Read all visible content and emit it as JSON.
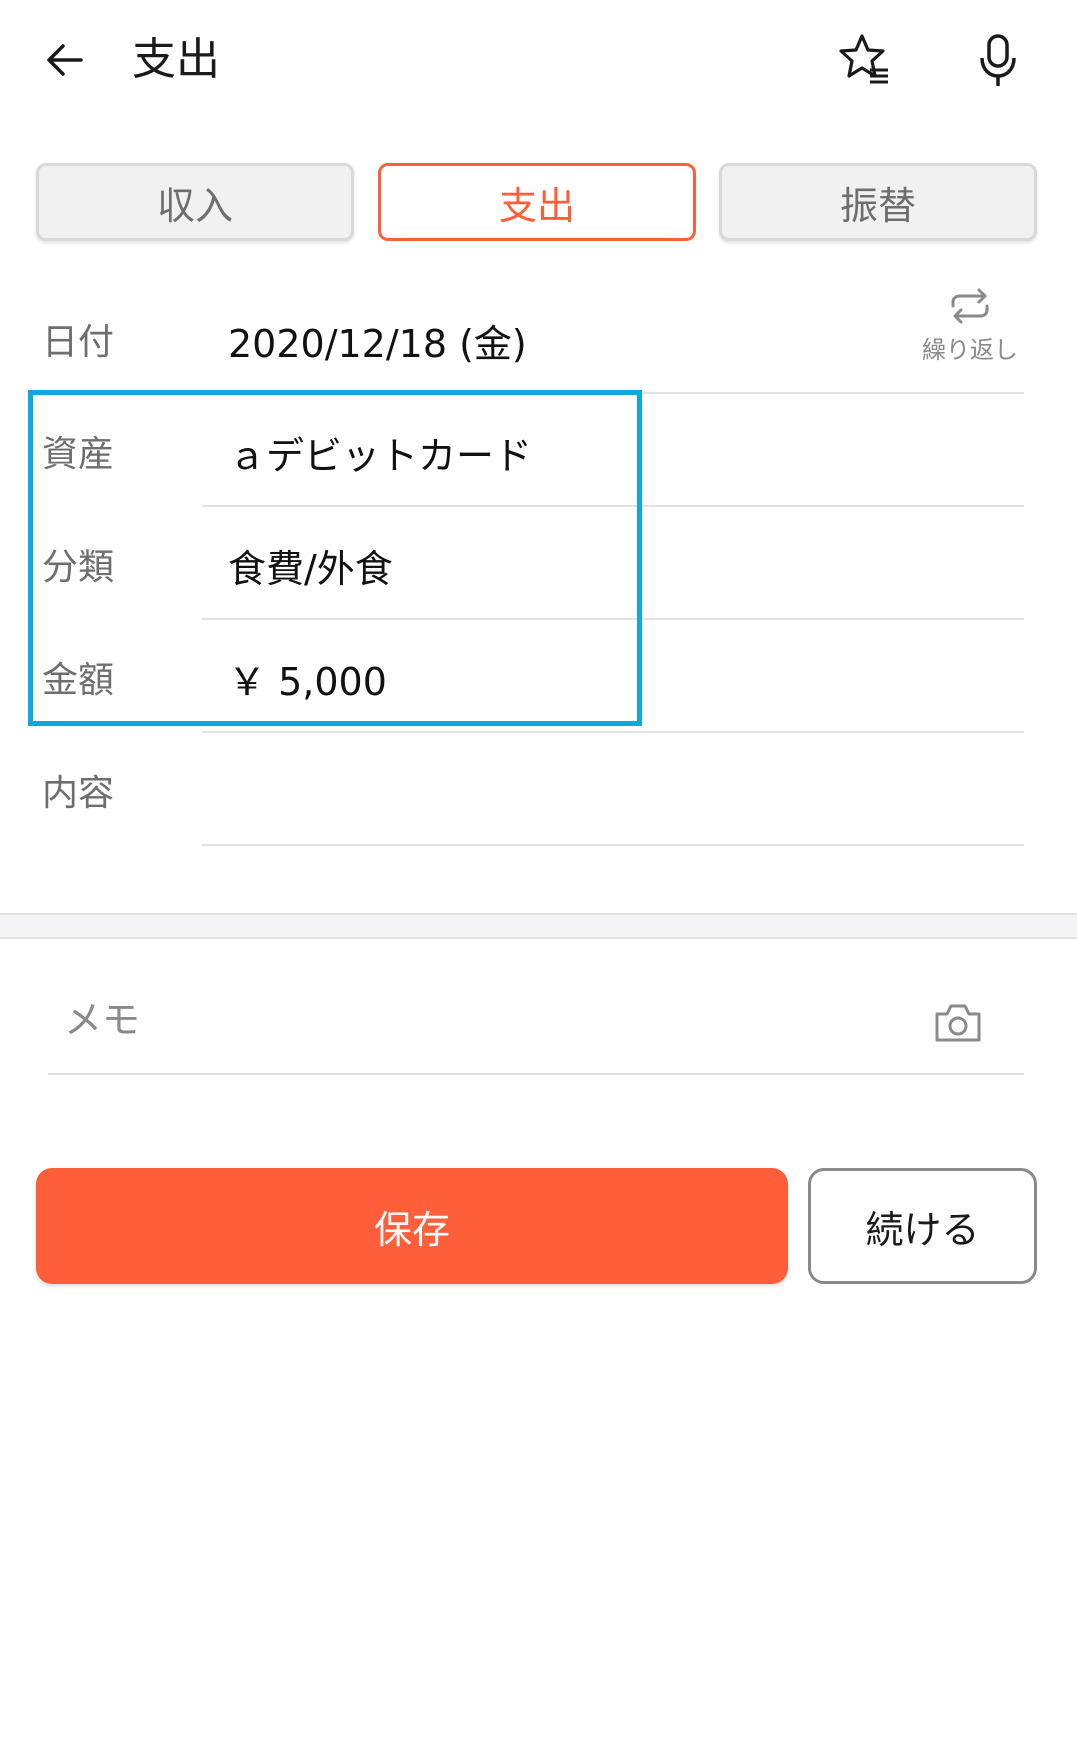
{
  "header": {
    "title": "支出",
    "back_icon": "arrow-left-icon",
    "favorites_icon": "star-list-icon",
    "voice_icon": "microphone-icon"
  },
  "tabs": [
    {
      "label": "収入",
      "active": false
    },
    {
      "label": "支出",
      "active": true
    },
    {
      "label": "振替",
      "active": false
    }
  ],
  "form": {
    "date": {
      "label": "日付",
      "value": "2020/12/18 (金)"
    },
    "repeat": {
      "label": "繰り返し",
      "icon": "repeat-icon"
    },
    "asset": {
      "label": "資産",
      "value": "ａデビットカード"
    },
    "category": {
      "label": "分類",
      "value": "食費/外食"
    },
    "amount": {
      "label": "金額",
      "value": "￥ 5,000"
    },
    "content": {
      "label": "内容",
      "value": ""
    }
  },
  "memo": {
    "placeholder": "メモ",
    "camera_icon": "camera-icon"
  },
  "actions": {
    "save_label": "保存",
    "continue_label": "続ける"
  },
  "colors": {
    "accent": "#ff5e3a",
    "highlight": "#0fa8dc",
    "muted_text": "#6e6e6e"
  }
}
